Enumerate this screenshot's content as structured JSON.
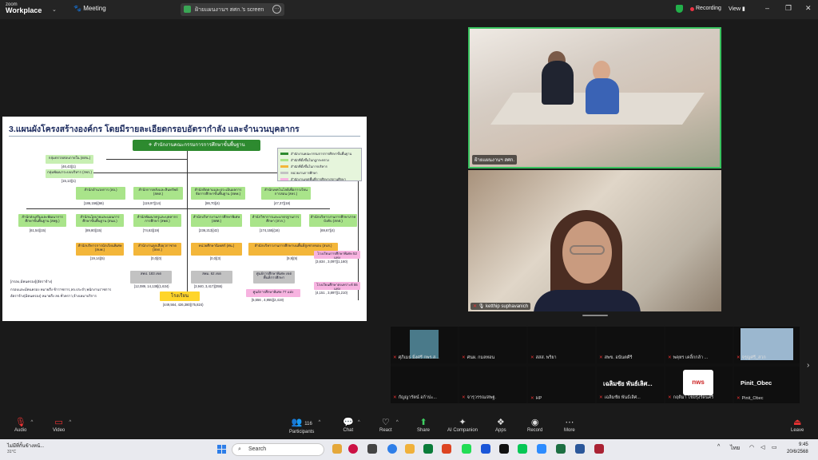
{
  "titlebar": {
    "app_line1": "zoom",
    "app_line2": "Workplace",
    "meeting_label": "Meeting",
    "share_tab": "ฝ้ายแผนงานฯ สศก.'s screen",
    "recording": "Recording",
    "view": "View"
  },
  "slide": {
    "title": "3.แผนผังโครงสร้างองค์กร โดยมีรายละเอียดกรอบอัตรากำลัง และจำนวนบุคลากร",
    "top": "สำนักงานคณะกรรมการการศึกษาขั้นพื้นฐาน",
    "side_boxes": [
      {
        "label": "กลุ่มตรวจสอบภายใน (ตสน.)",
        "count": "[46,43](1)"
      },
      {
        "label": "กลุ่มพัฒนาระบบบริหาร (กพร.)",
        "count": "[15,13](1)"
      }
    ],
    "row1": [
      {
        "label": "สำนักอำนวยการ (สอ.)",
        "count": "[186,156](66)"
      },
      {
        "label": "สำนักการคลังและสินทรัพย์ (สคส.)",
        "count": "[119,97](14)"
      },
      {
        "label": "สำนักติดตามและประเมินผลการจัดการศึกษาขั้นพื้นฐาน (สคพ.)",
        "count": "[86,70](4)"
      },
      {
        "label": "สำนักเทคโนโลยีเพื่อการเรียนการสอน (สทร.)",
        "count": "[47,37](18)"
      }
    ],
    "row2": [
      {
        "label": "สำนักส่งเสริมและพัฒนาการศึกษาขั้นพื้นฐาน (สพฐ.)",
        "count": "[61,54](15)"
      },
      {
        "label": "สำนักนโยบายและแผนการศึกษาขั้นพื้นฐาน (สนผ.)",
        "count": "[89,80](15)"
      },
      {
        "label": "สำนักพัฒนาครูและบุคลากรการศึกษา (สพค.)",
        "count": "[74,63](19)"
      },
      {
        "label": "สำนักบริหารงานการศึกษาพิเศษ (สศศ.)",
        "count": "[236,213](42)"
      },
      {
        "label": "สำนักวิชาการและมาตรฐานการศึกษา (สวก.)",
        "count": "[174,155](16)"
      },
      {
        "label": "สำนักบริหารงานการศึกษาภาคบังคับ (สกศ.)",
        "count": "[69,67](4)"
      }
    ],
    "row3": [
      {
        "label": "สำนักบริหารการนักเรียนพิเศษ (สบพ.)",
        "count": "[19,14](5)"
      },
      {
        "label": "สำนักงานลูกเสือยุวกาชาด (สลก.)",
        "count": "[0,0](0)"
      },
      {
        "label": "หน่วยศึกษานิเทศก์ (ศน.)",
        "count": "[0,0](3)"
      },
      {
        "label": "สำนักบริหารงานการศึกษาบนพื้นที่สูงชายขอบ (สบส.)",
        "count": "[9,9](9)"
      }
    ],
    "row4": [
      {
        "label": "สพป. 183 เขต",
        "count": "[12,089, 14,138](1,634)"
      },
      {
        "label": "สพม. 62 เขต",
        "count": "[3,940, 3,417](355)"
      },
      {
        "label": "ศูนย์การศึกษาพิเศษ เขตพื้นที่การศึกษา",
        "count": ""
      },
      {
        "label": "ศูนย์การศึกษาพิเศษ 77 แห่ง",
        "count": "[5,556 , 4,955](2,419)"
      },
      {
        "label": "โรงเรียนการศึกษาพิเศษ 52 แห่ง",
        "count": "[3,634 , 3,097](1,160)"
      },
      {
        "label": "โรงเรียนศึกษาสงเคราะห์ 55 แห่ง",
        "count": "[4,151 , 3,897](1,210)"
      }
    ],
    "school": {
      "label": "โรงเรียน",
      "count": "[449,564, 426,380](75,824)"
    },
    "legend": [
      "สำนักงานคณะกรรมการการศึกษาขั้นพื้นฐาน",
      "สำนักที่ตั้งขึ้นในกฎกระทรวง",
      "สำนักที่ตั้งขึ้นในการบริหาร",
      "หน่วยงานการศึกษา",
      "สำนักงานเขตพื้นที่การศึกษา/สถานศึกษา"
    ],
    "notes": [
      "[กรอบ,มีคนครอง](อัตราจ้าง)",
      "กรอบและมีคนครอง หมายถึง ข้าราชการ,ลจ.ประจำ,พนักงานราชการ",
      "อัตราจ้าง(มีคนครอง) หมายถึง ลจ.ชั่วคราว,จ้างเหมาบริการ"
    ]
  },
  "videos": {
    "top_label": "ฝ้ายแผนงานฯ สศก.",
    "main_label": "ketthip suphavanich"
  },
  "gallery": {
    "row1": [
      "ศุภิเมธ มิ่งศรี กพร.ส...",
      "ศนผ. กมลทอน",
      "สสส. พริยา",
      "สพข. อนันตคีรี",
      "พคุหร เคลิ้กกล้า ...",
      "จรุญศรี_สวก"
    ],
    "row2": [
      "กัญญารัตน์ อก้าปะ...",
      "จารุวรรณ/สพฐ.",
      "HP",
      "เฉลิมชัย พันธ์เลิศ...",
      "กฤติมา ไชยรุ่งรัตนศรี",
      "Pinit_Obec"
    ],
    "big1": "เฉลิมชัย พันธ์เลิศ...",
    "big2": "Pinit_Obec"
  },
  "toolbar": {
    "audio": "Audio",
    "video": "Video",
    "participants": "Participants",
    "participants_count": "116",
    "chat": "Chat",
    "react": "React",
    "share": "Share",
    "ai": "AI Companion",
    "apps": "Apps",
    "record": "Record",
    "more": "More",
    "leave": "Leave"
  },
  "taskbar": {
    "weather_title": "ไม่มีที่กั้นข้างหน้...",
    "weather_temp": "31°C",
    "search_placeholder": "Search",
    "lang": "ไทย",
    "time": "9:45",
    "date": "20/6/2568"
  }
}
